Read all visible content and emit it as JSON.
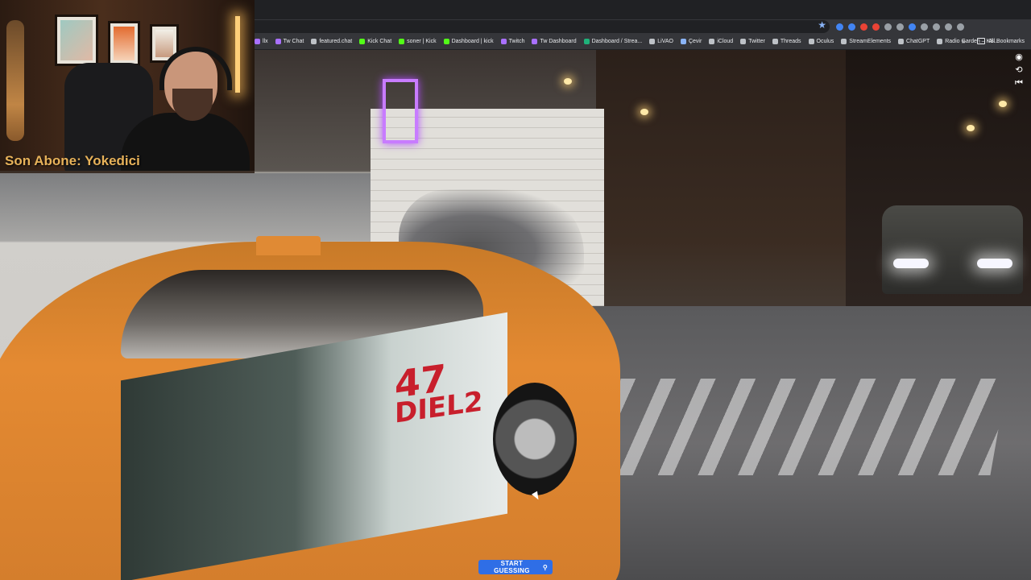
{
  "webcam": {
    "subscriber_text": "Son Abone: Yokedici"
  },
  "browser": {
    "bookmarks": [
      {
        "label": "llx",
        "color": "#a970ff"
      },
      {
        "label": "Tw Chat",
        "color": "#a970ff"
      },
      {
        "label": "featured.chat",
        "color": "#bdc1c6"
      },
      {
        "label": "Kick Chat",
        "color": "#53fc18"
      },
      {
        "label": "soner | Kick",
        "color": "#53fc18"
      },
      {
        "label": "Dashboard | kick",
        "color": "#53fc18"
      },
      {
        "label": "Twitch",
        "color": "#a970ff"
      },
      {
        "label": "Tw Dashboard",
        "color": "#a970ff"
      },
      {
        "label": "Dashboard / Strea...",
        "color": "#1fb27a"
      },
      {
        "label": "LiVAO",
        "color": "#bdc1c6"
      },
      {
        "label": "Çevir",
        "color": "#8ab4f8"
      },
      {
        "label": "iCloud",
        "color": "#bdc1c6"
      },
      {
        "label": "Twitter",
        "color": "#bdc1c6"
      },
      {
        "label": "Threads",
        "color": "#bdc1c6"
      },
      {
        "label": "Oculus",
        "color": "#bdc1c6"
      },
      {
        "label": "StreamElements",
        "color": "#bdc1c6"
      },
      {
        "label": "ChatGPT",
        "color": "#bdc1c6"
      },
      {
        "label": "Radio Garden – KB...",
        "color": "#bdc1c6"
      }
    ],
    "more_bookmarks": "»",
    "all_bookmarks": "All Bookmarks",
    "extension_colors": [
      "#4285f4",
      "#4285f4",
      "#ea4335",
      "#ea4335",
      "#9aa0a6",
      "#9aa0a6",
      "#4285f4",
      "#9aa0a6",
      "#9aa0a6",
      "#9aa0a6",
      "#9aa0a6"
    ]
  },
  "scene": {
    "taxi_ad_number": "47",
    "taxi_ad_text": "DIEL2"
  },
  "controls": {
    "compass_icon": "compass-icon",
    "refresh_icon": "refresh-icon",
    "return_icon": "return-to-start-icon"
  },
  "game": {
    "start_button_label": "START GUESSING",
    "start_button_icon": "map-pin-icon",
    "accent_color": "#2f6ee6"
  }
}
